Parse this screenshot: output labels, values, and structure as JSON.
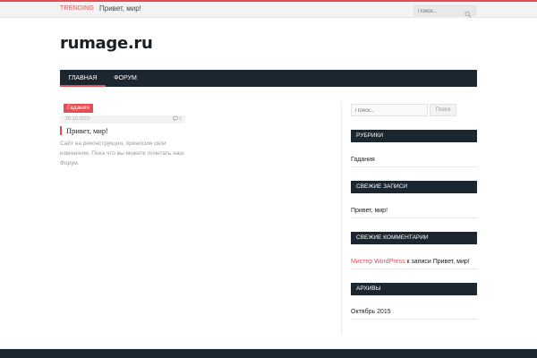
{
  "topbar": {
    "trending_label": "TRENDING",
    "trending_link": "Привет, мир!",
    "search_placeholder": "Поиск..."
  },
  "site": {
    "logo": "rumage.ru"
  },
  "nav": {
    "items": [
      {
        "label": "ГЛАВНАЯ",
        "active": true
      },
      {
        "label": "ФОРУМ",
        "active": false
      }
    ]
  },
  "post": {
    "category": "Гадания",
    "date": "20.10.2015",
    "comments": "1",
    "title": "Привет, мир!",
    "excerpt": "Сайт на реконструкции, приносим свои извинения. Пока что вы можете почитать наш Форум."
  },
  "sidebar": {
    "search_placeholder": "Поиск...",
    "search_button": "Поиск",
    "widgets": {
      "rubrics": {
        "title": "РУБРИКИ",
        "items": [
          "Гадания"
        ]
      },
      "recent_posts": {
        "title": "СВЕЖИЕ ЗАПИСИ",
        "items": [
          "Привет, мир!"
        ]
      },
      "recent_comments": {
        "title": "СВЕЖИЕ КОММЕНТАРИИ",
        "author": "Мистер WordPress",
        "connector": " к записи ",
        "post": "Привет, мир!"
      },
      "archives": {
        "title": "АРХИВЫ",
        "items": [
          "Октябрь 2015"
        ]
      }
    }
  },
  "colors": {
    "accent": "#e54e53",
    "dark": "#1c2630"
  },
  "icons": {
    "search": "search-icon",
    "comment": "comment-icon"
  }
}
